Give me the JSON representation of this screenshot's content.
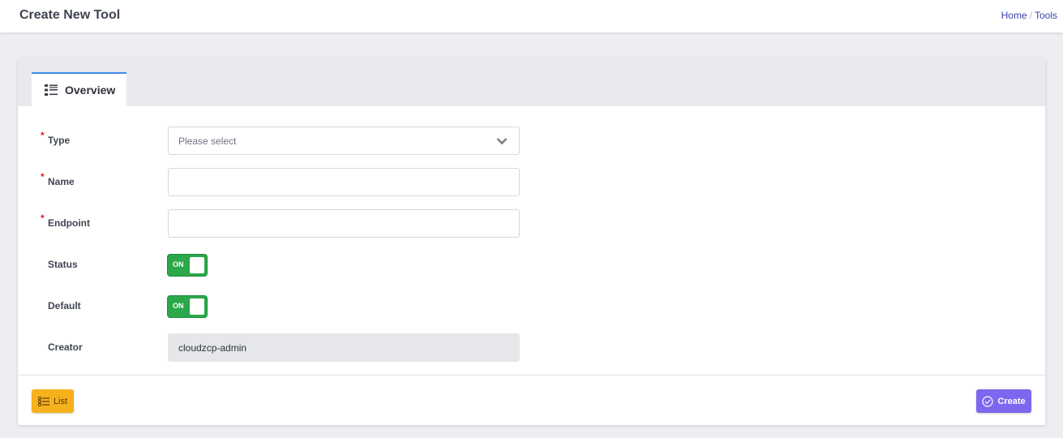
{
  "header": {
    "title": "Create New Tool",
    "breadcrumb": [
      {
        "label": "Home"
      },
      {
        "label": "Tools"
      }
    ],
    "separator": "/"
  },
  "tabs": [
    {
      "label": "Overview",
      "icon": "list-icon",
      "active": true
    }
  ],
  "form": {
    "type": {
      "label": "Type",
      "required": true,
      "placeholder": "Please select",
      "value": ""
    },
    "name": {
      "label": "Name",
      "required": true,
      "value": ""
    },
    "endpoint": {
      "label": "Endpoint",
      "required": true,
      "value": ""
    },
    "status": {
      "label": "Status",
      "toggle_text": "ON",
      "on": true
    },
    "default": {
      "label": "Default",
      "toggle_text": "ON",
      "on": true
    },
    "creator": {
      "label": "Creator",
      "value": "cloudzcp-admin"
    },
    "required_mark": "*"
  },
  "footer": {
    "list_label": "List",
    "create_label": "Create"
  },
  "colors": {
    "accent_tab": "#3d8be8",
    "toggle_on": "#2aa84a",
    "list_button": "#f7b11d",
    "create_button": "#7b68ee",
    "required": "#e02020",
    "link": "#3c3fb0"
  }
}
